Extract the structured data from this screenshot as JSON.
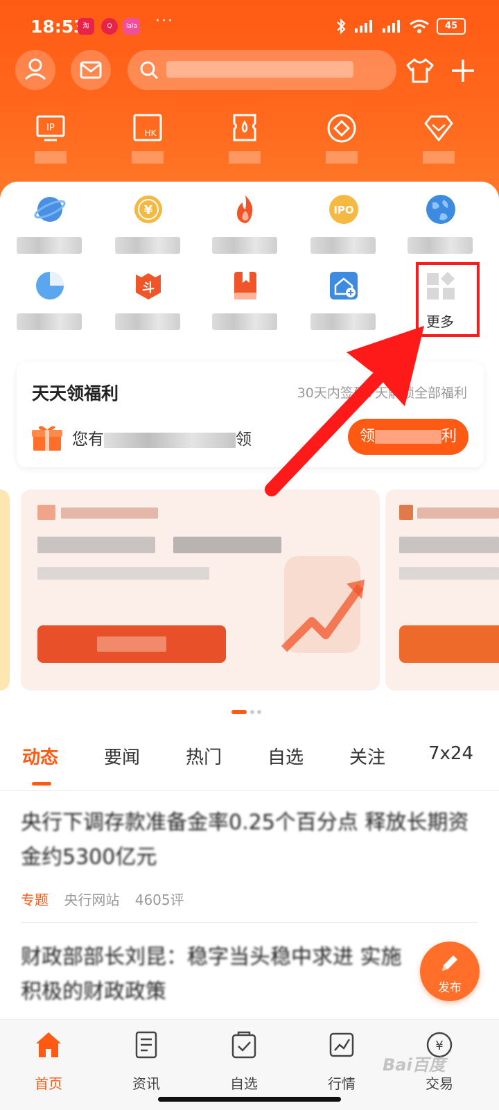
{
  "status_bar": {
    "time": "18:53",
    "battery": "45"
  },
  "grid_more_label": "更多",
  "welfare": {
    "title": "天天领福利",
    "subtitle": "30天内签到7天解锁全部福利",
    "message_prefix": "您有",
    "message_suffix": "领",
    "button_prefix": "领",
    "button_suffix": "利"
  },
  "news_tabs": [
    "动态",
    "要闻",
    "热门",
    "自选",
    "关注",
    "7x24"
  ],
  "news": [
    {
      "title": "央行下调存款准备金率0.25个百分点 释放长期资金约5300亿元",
      "tag": "专题",
      "source": "央行网站",
      "comments": "4605评"
    },
    {
      "title": "财政部部长刘昆：稳字当头稳中求进 实施积极的财政政策"
    }
  ],
  "fab_label": "发布",
  "bottom_nav": [
    {
      "label": "首页",
      "icon": "home-icon",
      "active": true
    },
    {
      "label": "资讯",
      "icon": "news-icon",
      "active": false
    },
    {
      "label": "自选",
      "icon": "watchlist-icon",
      "active": false
    },
    {
      "label": "行情",
      "icon": "market-icon",
      "active": false
    },
    {
      "label": "交易",
      "icon": "trade-icon",
      "active": false
    }
  ],
  "colors": {
    "accent": "#ff5a14",
    "highlight_box": "#ff1a1a",
    "arrow": "#ff1a1a"
  }
}
